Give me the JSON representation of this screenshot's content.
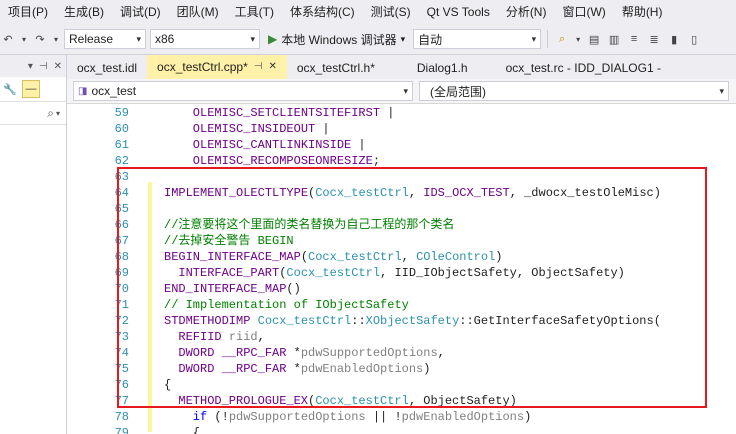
{
  "menu": [
    "项目(P)",
    "生成(B)",
    "调试(D)",
    "团队(M)",
    "工具(T)",
    "体系结构(C)",
    "测试(S)",
    "Qt VS Tools",
    "分析(N)",
    "窗口(W)",
    "帮助(H)"
  ],
  "toolbar": {
    "config": "Release",
    "platform": "x86",
    "run_label": "本地 Windows 调试器",
    "mode": "自动"
  },
  "tabs": [
    {
      "label": "ocx_test.idl",
      "active": false
    },
    {
      "label": "ocx_testCtrl.cpp*",
      "active": true
    },
    {
      "label": "ocx_testCtrl.h*",
      "active": false
    },
    {
      "label": "Dialog1.h",
      "active": false
    },
    {
      "label": "ocx_test.rc - IDD_DIALOG1 -",
      "active": false
    }
  ],
  "navbar": {
    "project": "ocx_test",
    "scope": "(全局范围)"
  },
  "code_lines": [
    {
      "n": "59",
      "parts": [
        [
          "mac",
          "OLEMISC_SETCLIENTSITEFIRST"
        ],
        [
          "pl",
          " |"
        ]
      ],
      "indent": 4
    },
    {
      "n": "60",
      "parts": [
        [
          "mac",
          "OLEMISC_INSIDEOUT"
        ],
        [
          "pl",
          " |"
        ]
      ],
      "indent": 4
    },
    {
      "n": "61",
      "parts": [
        [
          "mac",
          "OLEMISC_CANTLINKINSIDE"
        ],
        [
          "pl",
          " |"
        ]
      ],
      "indent": 4
    },
    {
      "n": "62",
      "parts": [
        [
          "mac",
          "OLEMISC_RECOMPOSEONRESIZE"
        ],
        [
          "pl",
          ";"
        ]
      ],
      "indent": 4
    },
    {
      "n": "63",
      "parts": [],
      "indent": 0
    },
    {
      "n": "64",
      "parts": [
        [
          "mac",
          "IMPLEMENT_OLECTLTYPE"
        ],
        [
          "pl",
          "("
        ],
        [
          "id",
          "Cocx_testCtrl"
        ],
        [
          "pl",
          ", "
        ],
        [
          "mac",
          "IDS_OCX_TEST"
        ],
        [
          "pl",
          ", "
        ],
        [
          "pl",
          "_dwocx_testOleMisc"
        ],
        [
          "pl",
          ")"
        ]
      ],
      "indent": 0
    },
    {
      "n": "65",
      "parts": [],
      "indent": 0
    },
    {
      "n": "66",
      "parts": [
        [
          "cm",
          "//注意要将这个里面的类名替换为自己工程的那个类名"
        ]
      ],
      "indent": 0
    },
    {
      "n": "67",
      "parts": [
        [
          "cm",
          "//去掉安全警告 BEGIN"
        ]
      ],
      "indent": 0
    },
    {
      "n": "68",
      "parts": [
        [
          "mac",
          "BEGIN_INTERFACE_MAP"
        ],
        [
          "pl",
          "("
        ],
        [
          "id",
          "Cocx_testCtrl"
        ],
        [
          "pl",
          ", "
        ],
        [
          "id",
          "COleControl"
        ],
        [
          "pl",
          ")"
        ]
      ],
      "indent": 0
    },
    {
      "n": "69",
      "parts": [
        [
          "mac",
          "INTERFACE_PART"
        ],
        [
          "pl",
          "("
        ],
        [
          "id",
          "Cocx_testCtrl"
        ],
        [
          "pl",
          ", IID_IObjectSafety, ObjectSafety)"
        ]
      ],
      "indent": 2
    },
    {
      "n": "70",
      "parts": [
        [
          "mac",
          "END_INTERFACE_MAP"
        ],
        [
          "pl",
          "()"
        ]
      ],
      "indent": 0
    },
    {
      "n": "71",
      "parts": [
        [
          "cm",
          "// Implementation of IObjectSafety"
        ]
      ],
      "indent": 0
    },
    {
      "n": "72",
      "parts": [
        [
          "mac",
          "STDMETHODIMP"
        ],
        [
          "pl",
          " "
        ],
        [
          "id",
          "Cocx_testCtrl"
        ],
        [
          "pl",
          "::"
        ],
        [
          "id",
          "XObjectSafety"
        ],
        [
          "pl",
          "::GetInterfaceSafetyOptions("
        ]
      ],
      "indent": 0
    },
    {
      "n": "73",
      "parts": [
        [
          "mac",
          "REFIID"
        ],
        [
          "pl",
          " "
        ],
        [
          "param",
          "riid"
        ],
        [
          "pl",
          ","
        ]
      ],
      "indent": 2
    },
    {
      "n": "74",
      "parts": [
        [
          "mac",
          "DWORD"
        ],
        [
          "pl",
          " "
        ],
        [
          "mac",
          "__RPC_FAR"
        ],
        [
          "pl",
          " *"
        ],
        [
          "param",
          "pdwSupportedOptions"
        ],
        [
          "pl",
          ","
        ]
      ],
      "indent": 2
    },
    {
      "n": "75",
      "parts": [
        [
          "mac",
          "DWORD"
        ],
        [
          "pl",
          " "
        ],
        [
          "mac",
          "__RPC_FAR"
        ],
        [
          "pl",
          " *"
        ],
        [
          "param",
          "pdwEnabledOptions"
        ],
        [
          "pl",
          ")"
        ]
      ],
      "indent": 2
    },
    {
      "n": "76",
      "parts": [
        [
          "pl",
          "{"
        ]
      ],
      "indent": 0
    },
    {
      "n": "77",
      "parts": [
        [
          "mac",
          "METHOD_PROLOGUE_EX"
        ],
        [
          "pl",
          "("
        ],
        [
          "id",
          "Cocx_testCtrl"
        ],
        [
          "pl",
          ", ObjectSafety)"
        ]
      ],
      "indent": 2
    },
    {
      "n": "78",
      "parts": [
        [
          "kw",
          "if"
        ],
        [
          "pl",
          " (!"
        ],
        [
          "param",
          "pdwSupportedOptions"
        ],
        [
          "pl",
          " || !"
        ],
        [
          "param",
          "pdwEnabledOptions"
        ],
        [
          "pl",
          ")"
        ]
      ],
      "indent": 4
    },
    {
      "n": "79",
      "parts": [
        [
          "pl",
          "{"
        ]
      ],
      "indent": 4
    }
  ]
}
